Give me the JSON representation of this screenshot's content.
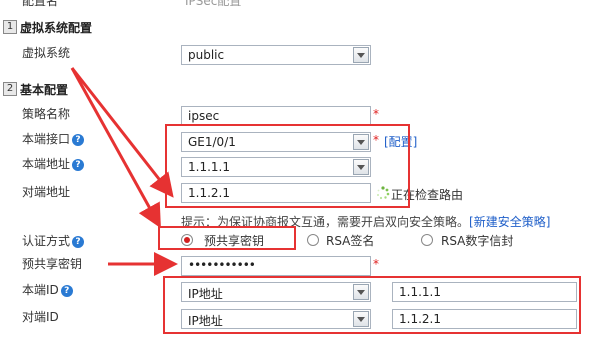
{
  "top_cut": {
    "label": "配置名",
    "value": "IPSec配置"
  },
  "sections": {
    "virtual": {
      "num": "1",
      "title": "虚拟系统配置"
    },
    "basic": {
      "num": "2",
      "title": "基本配置"
    }
  },
  "fields": {
    "virtual_system": {
      "label": "虚拟系统",
      "value": "public"
    },
    "policy_name": {
      "label": "策略名称",
      "value": "ipsec"
    },
    "local_interface": {
      "label": "本端接口",
      "value": "GE1/0/1",
      "link": "[配置]"
    },
    "local_address": {
      "label": "本端地址",
      "value": "1.1.1.1"
    },
    "peer_address": {
      "label": "对端地址",
      "value": "1.1.2.1",
      "status": "正在检查路由"
    },
    "tip": {
      "text": "提示：为保证协商报文互通，需要开启双向安全策略。",
      "link": "[新建安全策略]"
    },
    "auth_method": {
      "label": "认证方式",
      "options": [
        "预共享密钥",
        "RSA签名",
        "RSA数字信封"
      ],
      "selected": 0
    },
    "psk": {
      "label": "预共享密钥",
      "value": "•••••••••••"
    },
    "local_id": {
      "label": "本端ID",
      "type": "IP地址",
      "value": "1.1.1.1"
    },
    "peer_id": {
      "label": "对端ID",
      "type": "IP地址",
      "value": "1.1.2.1"
    }
  },
  "help_glyph": "?",
  "required_mark": "*",
  "colors": {
    "highlight": "#e63232",
    "link": "#1f5fc9",
    "help": "#2a7ad3"
  }
}
